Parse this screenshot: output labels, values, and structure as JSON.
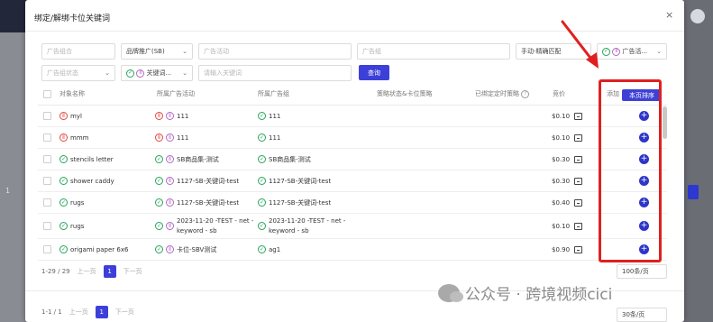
{
  "modal": {
    "title": "绑定/解绑卡位关键词",
    "close_icon": "×"
  },
  "filters": {
    "campaign_group_placeholder": "广告组合",
    "ad_type": "品牌推广(SB)",
    "campaign_placeholder": "广告活动",
    "ad_group_placeholder": "广告组",
    "match_type": "手动-精确匹配",
    "ad_status": "广告活...",
    "ad_group_status_placeholder": "广告组状态",
    "keyword_scope": "关键词...",
    "keyword_placeholder": "请输入关键词",
    "search_label": "查询"
  },
  "table": {
    "headers": {
      "target": "对象名称",
      "campaign": "所属广告活动",
      "ad_group": "所属广告组",
      "strategy": "策略状态&卡位策略",
      "bound_strategy": "已绑定定时策略",
      "bid": "竞价",
      "add": "添加",
      "sort": "本页排序"
    },
    "rows": [
      {
        "target": "myl",
        "target_status": "paused",
        "campaign": "111",
        "campaign_status": "paused",
        "ad_group": "111",
        "ad_group_status": "enabled",
        "bid": "$0.10"
      },
      {
        "target": "mmm",
        "target_status": "paused",
        "campaign": "111",
        "campaign_status": "paused",
        "ad_group": "111",
        "ad_group_status": "enabled",
        "bid": "$0.10"
      },
      {
        "target": "stencils letter",
        "target_status": "enabled",
        "campaign": "SB商品集-测试",
        "campaign_status": "enabled",
        "ad_group": "SB商品集-测试",
        "ad_group_status": "enabled",
        "bid": "$0.30"
      },
      {
        "target": "shower caddy",
        "target_status": "enabled",
        "campaign": "1127-SB-关键词-test",
        "campaign_status": "paused",
        "ad_group": "1127-SB-关键词-test",
        "ad_group_status": "enabled",
        "bid": "$0.30"
      },
      {
        "target": "rugs",
        "target_status": "enabled",
        "campaign": "1127-SB-关键词-test",
        "campaign_status": "paused",
        "ad_group": "1127-SB-关键词-test",
        "ad_group_status": "enabled",
        "bid": "$0.40"
      },
      {
        "target": "rugs",
        "target_status": "enabled",
        "campaign": "2023-11-20 -TEST - net -keyword - sb",
        "campaign_status": "paused",
        "ad_group": "2023-11-20 -TEST - net -keyword - sb",
        "ad_group_status": "enabled",
        "bid": "$0.10"
      },
      {
        "target": "origami paper 6x6",
        "target_status": "enabled",
        "campaign": "卡位-SBV测试",
        "campaign_status": "paused",
        "ad_group": "ag1",
        "ad_group_status": "enabled",
        "bid": "$0.90"
      }
    ]
  },
  "pagination": {
    "range": "1-29 / 29",
    "prev": "上一页",
    "page": "1",
    "next": "下一页",
    "page_size": "100条/页"
  },
  "bottom_pagination": {
    "range": "1-1 / 1",
    "prev": "上一页",
    "page": "1",
    "next": "下一页",
    "page_size": "30条/页"
  },
  "watermark": {
    "text": "公众号 · 跨境视频cici"
  },
  "background": {
    "row_number": "1"
  },
  "colors": {
    "primary": "#3d40d8",
    "enabled": "#25a55a",
    "paused": "#e0473e",
    "highlight": "#e02020"
  }
}
